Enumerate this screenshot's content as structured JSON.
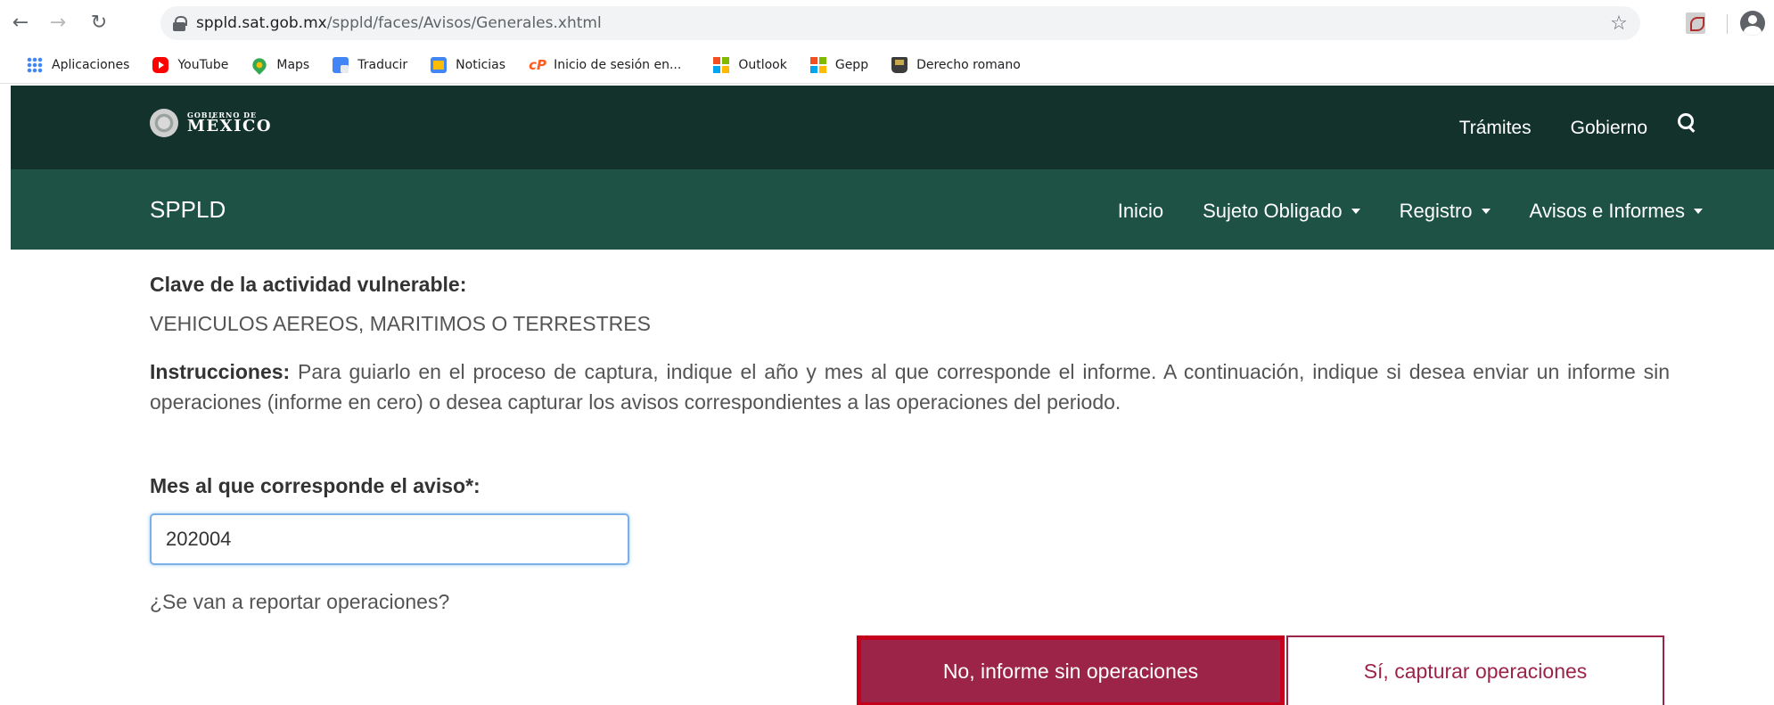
{
  "browser": {
    "url_host": "sppld.sat.gob.mx",
    "url_path": "/sppld/faces/Avisos/Generales.xhtml",
    "bookmarks": [
      {
        "label": "Aplicaciones",
        "icon": "apps-grid-icon"
      },
      {
        "label": "YouTube",
        "icon": "youtube-icon"
      },
      {
        "label": "Maps",
        "icon": "maps-pin-icon"
      },
      {
        "label": "Traducir",
        "icon": "translate-icon"
      },
      {
        "label": "Noticias",
        "icon": "news-icon"
      },
      {
        "label": "Inicio de sesión en...",
        "icon": "cp-icon"
      },
      {
        "label": "Outlook",
        "icon": "microsoft-icon"
      },
      {
        "label": "Gepp",
        "icon": "microsoft-icon"
      },
      {
        "label": "Derecho romano",
        "icon": "book-icon"
      }
    ]
  },
  "gob_header": {
    "logo_small": "GOBIERNO DE",
    "logo_big": "MÉXICO",
    "links": [
      "Trámites",
      "Gobierno"
    ]
  },
  "site_nav": {
    "brand": "SPPLD",
    "items": [
      {
        "label": "Inicio",
        "dropdown": false
      },
      {
        "label": "Sujeto Obligado",
        "dropdown": true
      },
      {
        "label": "Registro",
        "dropdown": true
      },
      {
        "label": "Avisos e Informes",
        "dropdown": true
      }
    ]
  },
  "form": {
    "activity_label": "Clave de la actividad vulnerable:",
    "activity_value": "VEHICULOS AEREOS, MARITIMOS O TERRESTRES",
    "instructions_title": "Instrucciones:",
    "instructions_text": " Para guiarlo en el proceso de captura, indique el año y mes al que corresponde el informe. A continuación, indique si desea enviar un informe sin operaciones (informe en cero) o desea capturar los avisos correspondientes a las operaciones del periodo.",
    "month_label": "Mes al que corresponde el aviso*:",
    "month_value": "202004",
    "question": "¿Se van a reportar operaciones?",
    "btn_no": "No, informe sin operaciones",
    "btn_si": "Sí, capturar operaciones"
  },
  "colors": {
    "gob_dark": "#13322b",
    "gob_green": "#1e5245",
    "primary_red": "#9d2449",
    "highlight_border": "#c4001d"
  }
}
